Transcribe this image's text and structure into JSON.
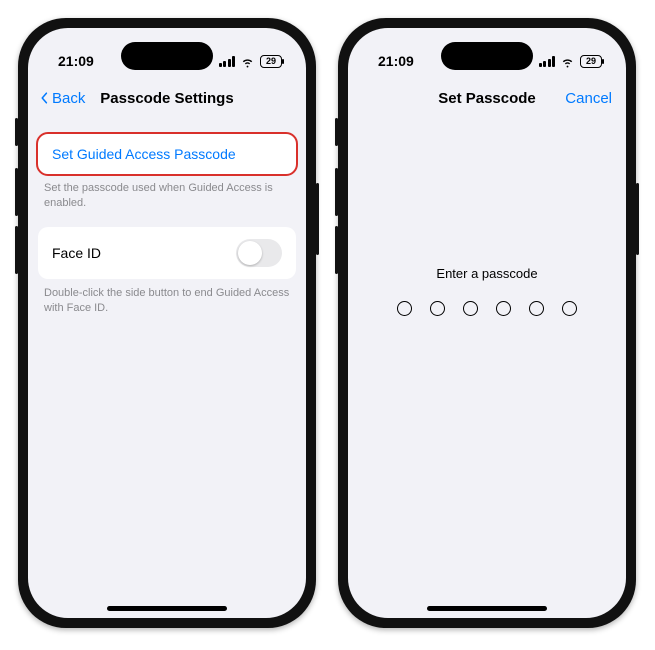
{
  "status": {
    "time": "21:09",
    "battery": "29"
  },
  "left": {
    "nav": {
      "back": "Back",
      "title": "Passcode Settings"
    },
    "row1": {
      "label": "Set Guided Access Passcode"
    },
    "row1_footer": "Set the passcode used when Guided Access is enabled.",
    "row2": {
      "label": "Face ID"
    },
    "row2_footer": "Double-click the side button to end Guided Access with Face ID."
  },
  "right": {
    "nav": {
      "title": "Set Passcode",
      "cancel": "Cancel"
    },
    "prompt": "Enter a passcode",
    "digits": 6
  }
}
